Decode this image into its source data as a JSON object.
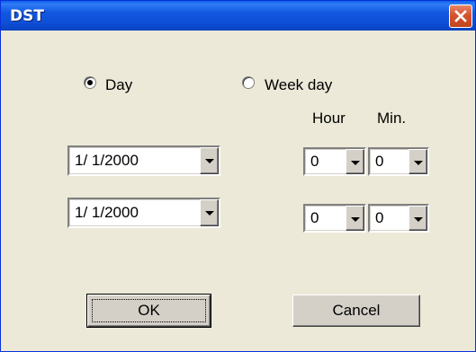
{
  "window": {
    "title": "DST",
    "close_icon": "close-icon"
  },
  "mode": {
    "options": [
      {
        "label": "Day",
        "selected": true
      },
      {
        "label": "Week day",
        "selected": false
      }
    ]
  },
  "time_headers": {
    "hour": "Hour",
    "min": "Min."
  },
  "start": {
    "date": "1/ 1/2000",
    "hour": "0",
    "min": "0"
  },
  "end": {
    "date": "1/ 1/2000",
    "hour": "0",
    "min": "0"
  },
  "buttons": {
    "ok": "OK",
    "cancel": "Cancel"
  }
}
